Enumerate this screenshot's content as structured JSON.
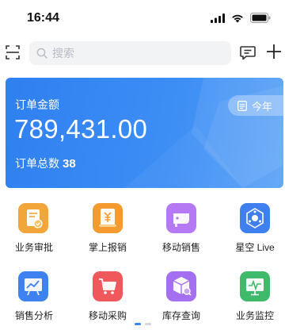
{
  "status": {
    "time": "16:44"
  },
  "search": {
    "placeholder": "搜索",
    "value": ""
  },
  "summary": {
    "label": "订单金额",
    "amount": "789,431.00",
    "count_label": "订单总数",
    "count": "38",
    "period": "今年",
    "accent": "#3a8cf4"
  },
  "apps": [
    {
      "label": "业务审批",
      "icon": "approval-icon",
      "color": "#f0a538"
    },
    {
      "label": "掌上报销",
      "icon": "reimburse-icon",
      "color": "#f39b2e"
    },
    {
      "label": "移动销售",
      "icon": "mobile-sales-icon",
      "color": "#b57af3"
    },
    {
      "label": "星空 Live",
      "icon": "live-icon",
      "color": "#3f7ff0"
    },
    {
      "label": "销售分析",
      "icon": "sales-analysis-icon",
      "color": "#3e82f1"
    },
    {
      "label": "移动采购",
      "icon": "cart-icon",
      "color": "#f0595b"
    },
    {
      "label": "库存查询",
      "icon": "inventory-icon",
      "color": "#a46ff0"
    },
    {
      "label": "业务监控",
      "icon": "monitor-icon",
      "color": "#3fba6a"
    }
  ],
  "pager": {
    "pages": 2,
    "current": 1
  }
}
